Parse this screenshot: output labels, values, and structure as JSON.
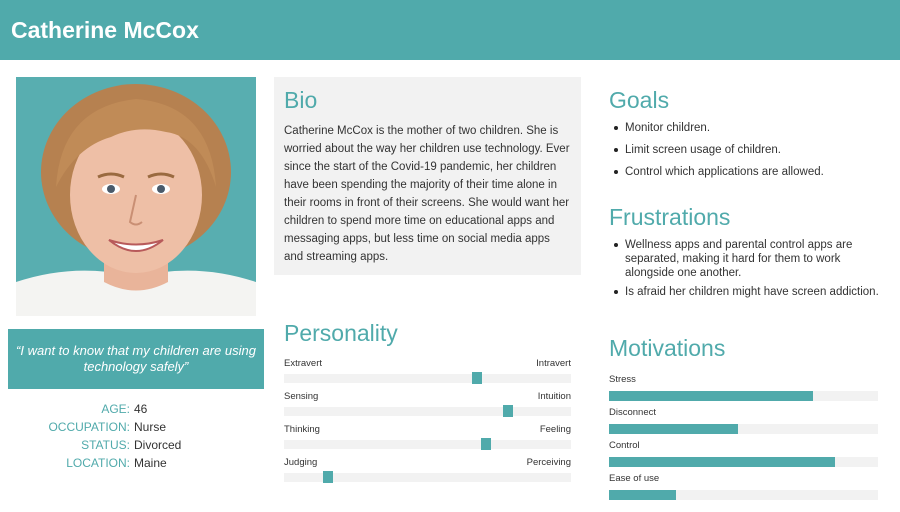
{
  "header": {
    "name": "Catherine McCox"
  },
  "colors": {
    "accent": "#50aaab",
    "panel": "#f2f2f2",
    "text": "#333333"
  },
  "quote": "“I want to know that my children are using technology safely”",
  "facts": [
    {
      "label": "AGE:",
      "value": "46"
    },
    {
      "label": "OCCUPATION:",
      "value": "Nurse"
    },
    {
      "label": "STATUS:",
      "value": "Divorced"
    },
    {
      "label": "LOCATION:",
      "value": "Maine"
    }
  ],
  "bio": {
    "title": "Bio",
    "text": "Catherine McCox is the mother of two children. She is worried about the way her children use technology. Ever since the start of the Covid-19 pandemic, her children have been spending the majority of their time alone in their rooms in front of their screens. She would want her children to spend more time on educational apps and messaging apps, but less time on social media apps and streaming apps."
  },
  "personality": {
    "title": "Personality",
    "traits": [
      {
        "left": "Extravert",
        "right": "Intravert",
        "value": 0.68
      },
      {
        "left": "Sensing",
        "right": "Intuition",
        "value": 0.79
      },
      {
        "left": "Thinking",
        "right": "Feeling",
        "value": 0.71
      },
      {
        "left": "Judging",
        "right": "Perceiving",
        "value": 0.14
      }
    ]
  },
  "goals": {
    "title": "Goals",
    "items": [
      "Monitor children.",
      "Limit screen usage of children.",
      "Control which applications are allowed."
    ]
  },
  "frustrations": {
    "title": "Frustrations",
    "items": [
      "Wellness apps and parental control apps are separated, making it hard for them to work alongside one another.",
      "Is afraid her children might have screen addiction."
    ]
  },
  "motivations": {
    "title": "Motivations",
    "items": [
      {
        "label": "Stress",
        "value": 0.76
      },
      {
        "label": "Disconnect",
        "value": 0.48
      },
      {
        "label": "Control",
        "value": 0.84
      },
      {
        "label": "Ease of use",
        "value": 0.25
      }
    ]
  }
}
